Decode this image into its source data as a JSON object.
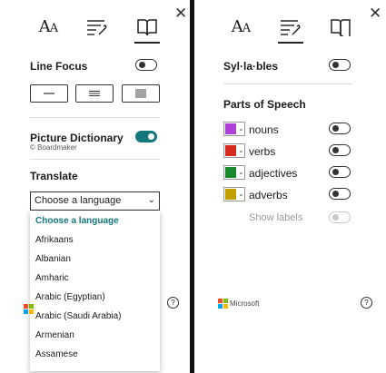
{
  "left": {
    "tabs": [
      {
        "name": "text-preferences-icon",
        "glyph_big": "A",
        "glyph_small": "A"
      },
      {
        "name": "grammar-options-icon"
      },
      {
        "name": "reading-preferences-icon",
        "active": true
      }
    ],
    "line_focus": {
      "label": "Line Focus",
      "on": false
    },
    "picture_dictionary": {
      "label": "Picture Dictionary",
      "sublabel": "© Boardmaker",
      "on": true
    },
    "translate": {
      "label": "Translate",
      "selected": "Choose a language",
      "options": [
        "Choose a language",
        "Afrikaans",
        "Albanian",
        "Amharic",
        "Arabic (Egyptian)",
        "Arabic (Saudi Arabia)",
        "Armenian",
        "Assamese"
      ]
    },
    "close_glyph": "✕",
    "help_glyph": "?"
  },
  "right": {
    "syllables": {
      "label": "Syl·la·bles",
      "on": false
    },
    "parts_of_speech": {
      "title": "Parts of Speech",
      "items": [
        {
          "label": "nouns",
          "color": "#b040d8",
          "on": false
        },
        {
          "label": "verbs",
          "color": "#d42b1e",
          "on": false
        },
        {
          "label": "adjectives",
          "color": "#1a8a2e",
          "on": false
        },
        {
          "label": "adverbs",
          "color": "#c2a000",
          "on": false
        }
      ],
      "show_labels": {
        "label": "Show labels",
        "on": false,
        "disabled": true
      }
    },
    "brand": "Microsoft",
    "close_glyph": "✕",
    "help_glyph": "?"
  },
  "colors": {
    "accent": "#13777b",
    "ms_red": "#f25022",
    "ms_green": "#7fba00",
    "ms_blue": "#00a4ef",
    "ms_yellow": "#ffb900"
  }
}
